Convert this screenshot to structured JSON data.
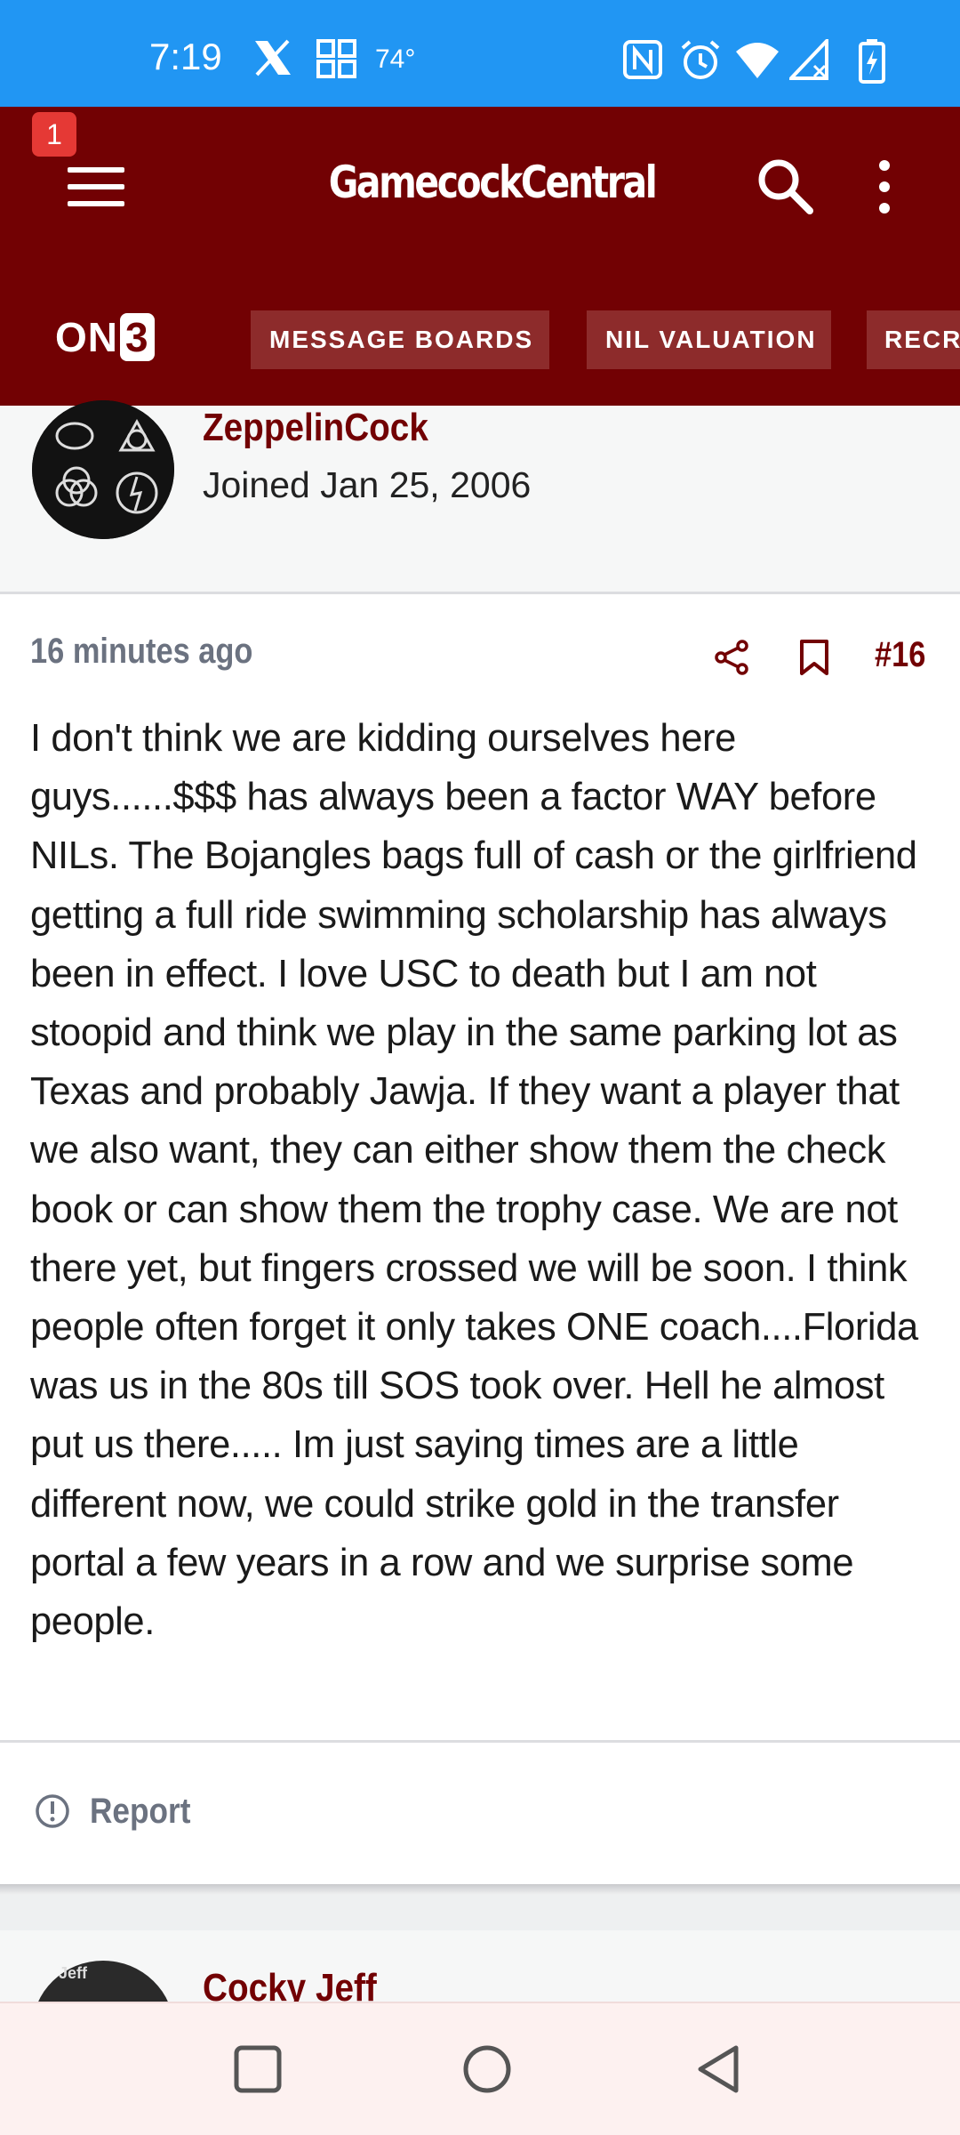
{
  "status_bar": {
    "time": "7:19",
    "temperature": "74°",
    "icons": [
      "x-icon",
      "widget-icon",
      "nfc-icon",
      "alarm-icon",
      "wifi-icon",
      "signal-icon",
      "battery-icon"
    ]
  },
  "header": {
    "notification_count": "1",
    "brand_title": "GamecockCentral",
    "logo_text_on": "ON",
    "logo_text_3": "3",
    "nav_tabs": [
      {
        "label": "MESSAGE BOARDS"
      },
      {
        "label": "NIL VALUATION"
      },
      {
        "label": "RECRUITING"
      }
    ]
  },
  "post": {
    "author": "ZeppelinCock",
    "joined": "Joined Jan 25, 2006",
    "time_ago": "16 minutes ago",
    "post_number": "#16",
    "body": "I don't think we are kidding ourselves here guys......$$$ has always been a factor WAY before NILs. The Bojangles bags full of cash or the girlfriend getting a full ride swimming scholarship has always been in effect. I love USC to death but I am not stoopid and think we play in the same parking lot as Texas and probably Jawja. If they want a player that we also want, they can either show them the check book or can show them the trophy case. We are not there yet, but fingers crossed we will be soon. I think people often forget it only takes ONE coach....Florida was us in the 80s till SOS took over. Hell he almost put us there..... Im just saying times are a little different now, we could strike gold in the transfer portal a few years in a row and we surprise some people.",
    "report_label": "Report"
  },
  "next_post": {
    "author": "Cocky Jeff",
    "avatar_text": "Jeff"
  },
  "colors": {
    "status_bar": "#2196f3",
    "brand": "#720103",
    "tab_bg": "#8d2b2b",
    "muted": "#6b7280"
  }
}
